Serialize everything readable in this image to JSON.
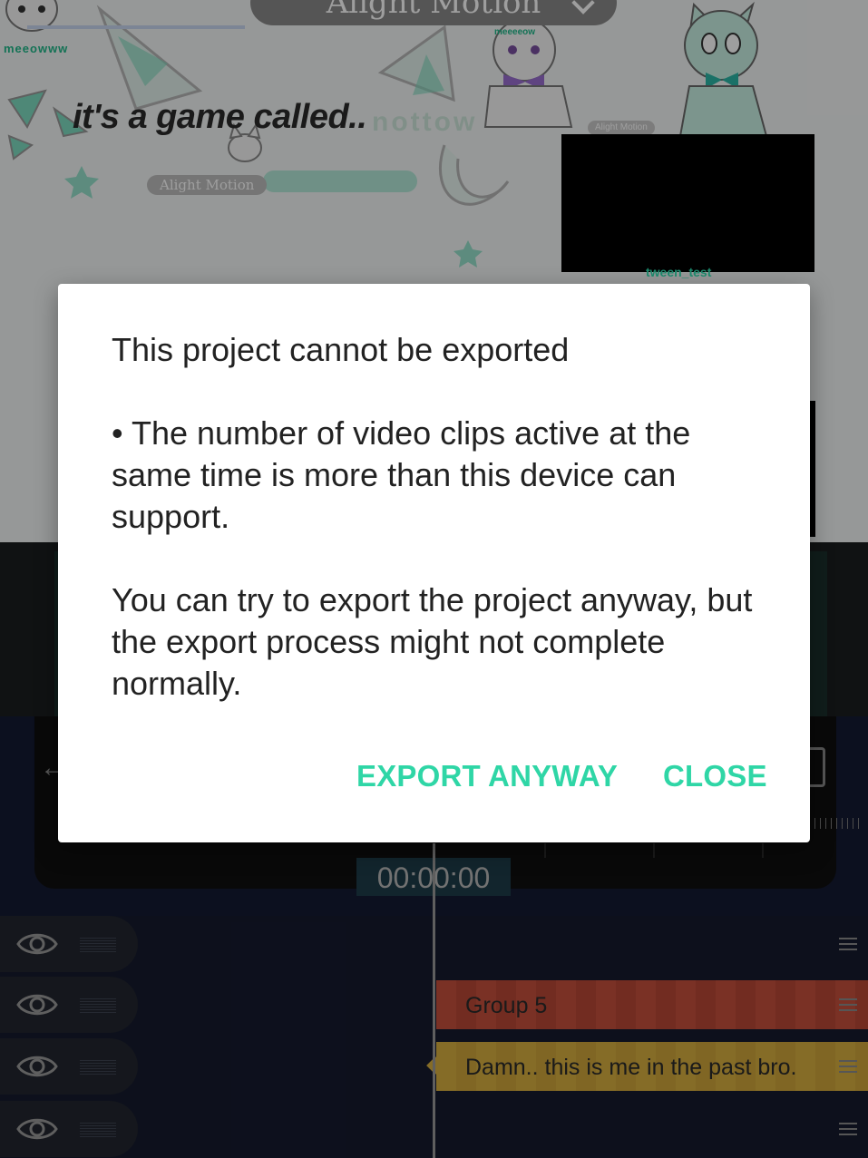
{
  "preview": {
    "title": "Alight Motion",
    "caption": "it's a game called..",
    "caption_ghost": "nottow",
    "watermark_label": "Alight Motion",
    "watermark_small": "Alight Motion",
    "video_label": "tween_test",
    "meow_text": "meeowww",
    "meow_text_2": "meeeeow"
  },
  "dialog": {
    "title": "This project cannot be exported",
    "bullet": "• The number of video clips active at the same time is more than this device can support.",
    "note": "You can try to export the project anyway, but the export process might not complete normally.",
    "export_anyway_label": "EXPORT ANYWAY",
    "close_label": "CLOSE",
    "accent_color": "#2fd6a6"
  },
  "timeline": {
    "current_time": "00:00:00",
    "layers": [
      {
        "clip_label": "",
        "clip_color": ""
      },
      {
        "clip_label": "Group 5",
        "clip_color": "#c5503d"
      },
      {
        "clip_label": "Damn.. this is me in the past bro.",
        "clip_color": "#d7ae3f"
      },
      {
        "clip_label": "",
        "clip_color": ""
      }
    ]
  },
  "icons": [
    "back-arrow-icon",
    "fullscreen-icon",
    "eye-icon",
    "drag-handle-icon",
    "chevron-down-icon"
  ]
}
